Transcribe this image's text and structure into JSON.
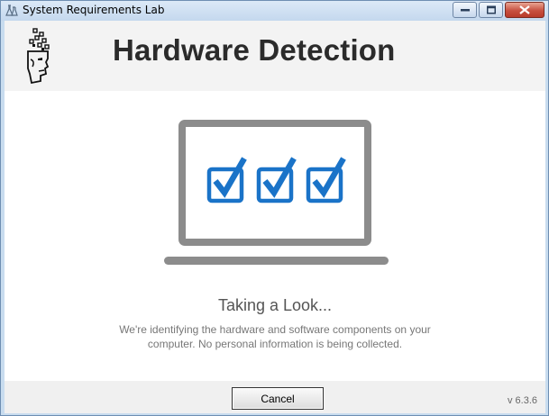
{
  "window": {
    "title": "System Requirements Lab",
    "controls": {
      "minimize": "minimize",
      "maximize": "maximize",
      "close": "close"
    }
  },
  "header": {
    "title": "Hardware Detection",
    "logo_icon": "robot-head-logo-icon"
  },
  "main": {
    "illustration_icon": "laptop-checkmarks-icon",
    "status_title": "Taking a Look...",
    "status_description": "We're identifying the hardware and software components on your computer. No personal information is being collected."
  },
  "footer": {
    "cancel_label": "Cancel",
    "version": "v 6.3.6"
  },
  "colors": {
    "accent_blue": "#1a73c8",
    "laptop_gray": "#8c8c8c",
    "heading_text": "#2b2b2b"
  }
}
